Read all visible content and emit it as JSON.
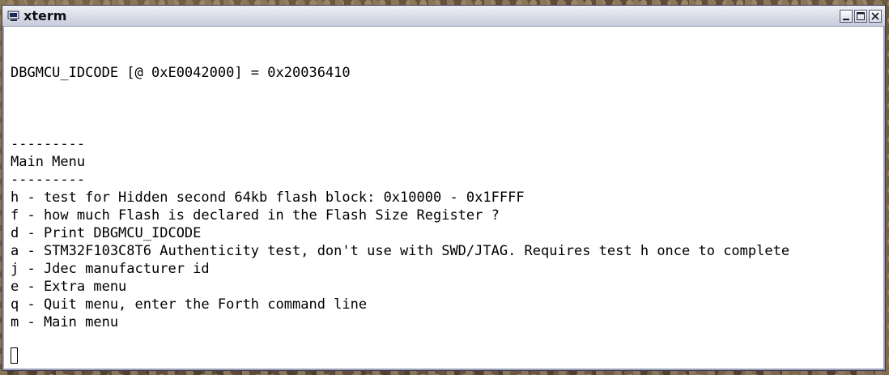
{
  "window": {
    "title": "xterm",
    "icon": "terminal-icon"
  },
  "titlebar_controls": [
    {
      "name": "minimize-button",
      "icon": "minimize-icon"
    },
    {
      "name": "maximize-button",
      "icon": "maximize-icon"
    },
    {
      "name": "close-button",
      "icon": "close-icon"
    }
  ],
  "terminal": {
    "lines": [
      "DBGMCU_IDCODE [@ 0xE0042000] = 0x20036410",
      "",
      "",
      "",
      "---------",
      "Main Menu",
      "---------",
      "h - test for Hidden second 64kb flash block: 0x10000 - 0x1FFFF",
      "f - how much Flash is declared in the Flash Size Register ?",
      "d - Print DBGMCU_IDCODE",
      "a - STM32F103C8T6 Authenticity test, don't use with SWD/JTAG. Requires test h once to complete",
      "j - Jdec manufacturer id",
      "e - Extra menu",
      "q - Quit menu, enter the Forth command line",
      "m - Main menu"
    ]
  },
  "colors": {
    "terminal_bg": "#ffffff",
    "terminal_fg": "#000000",
    "titlebar": "#d8dae6"
  }
}
